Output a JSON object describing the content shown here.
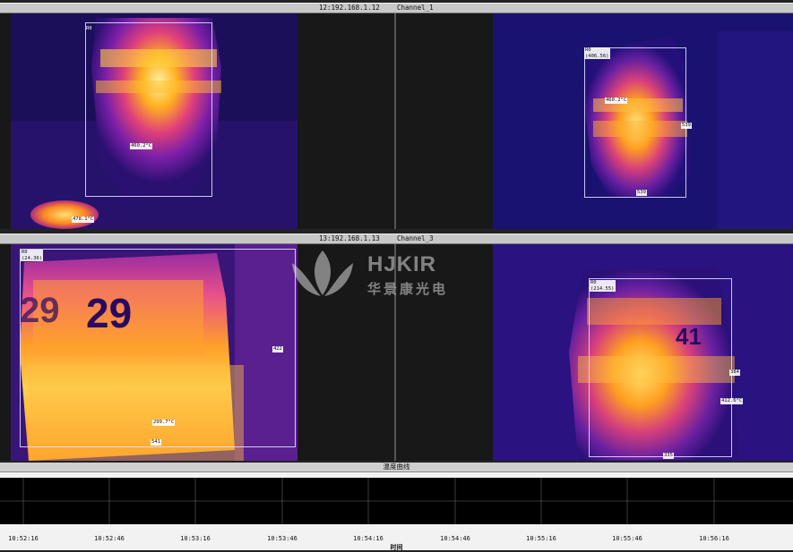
{
  "panels": {
    "top": {
      "ip": "12:192.168.1.12",
      "channel": "Channel_1"
    },
    "bottom": {
      "ip": "13:192.168.1.13",
      "channel": "Channel_3"
    }
  },
  "views": {
    "tl": {
      "roi": "R0",
      "max": "460.2°C",
      "spot": "478.1°C"
    },
    "tr": {
      "roi": "R0",
      "roi_val": "(406.56)",
      "max": "460.2°C",
      "t1": "539",
      "t2": "539"
    },
    "bl": {
      "roi": "R0",
      "roi_val": "(24.36)",
      "max": "299.7°C",
      "t1": "422",
      "t2": "541",
      "num_left": "29",
      "num_main": "29"
    },
    "br": {
      "roi": "R0",
      "roi_val": "(214.55)",
      "max": "412.6°C",
      "t1": "384",
      "t2": "335",
      "num": "41"
    }
  },
  "watermark": {
    "brand": "HJKIR",
    "sub": "华景康光电"
  },
  "chart": {
    "title": "温度曲线",
    "xlabel": "时间",
    "ticks": [
      "10:52:16",
      "10:52:46",
      "10:53:16",
      "10:53:46",
      "10:54:16",
      "10:54:46",
      "10:55:16",
      "10:55:46",
      "10:56:16"
    ]
  }
}
